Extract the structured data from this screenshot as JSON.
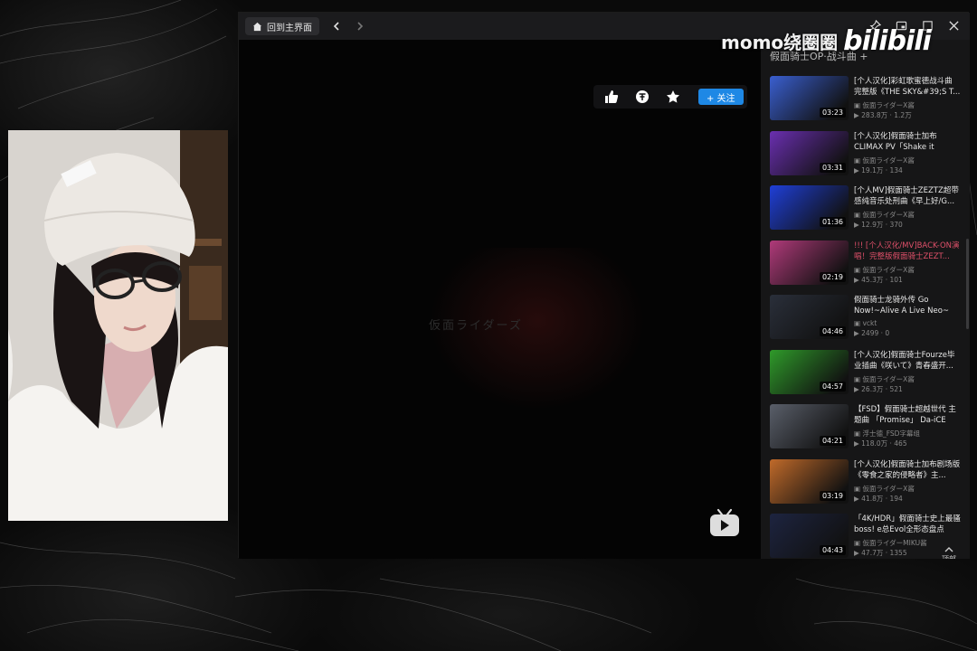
{
  "toolbar": {
    "home_label": "回到主界面"
  },
  "watermark": {
    "channel": "momo绕圈圈",
    "logo": "bilibili"
  },
  "player": {
    "stage_text": "仮面ライダーズ",
    "follow_label": "+ 关注"
  },
  "sidebar": {
    "list_title": "假面骑士OP·战斗曲 +",
    "to_top": "顶部",
    "items": [
      {
        "title": "[个人汉化]彩虹歌蜜德战斗曲 完整版《THE SKY&#39;S T...",
        "duration": "03:23",
        "uploader": "仮面ライダーX酱",
        "stats": "283.8万 · 1.2万",
        "red": false,
        "thumb": "#3a5fd0"
      },
      {
        "title": "[个人汉化]假面骑士加布 CLIMAX PV「Shake it off」！ 总...",
        "duration": "03:31",
        "uploader": "仮面ライダーX酱",
        "stats": "19.1万 · 134",
        "red": false,
        "thumb": "#6a2fb0"
      },
      {
        "title": "[个人MV]假面骑士ZEZTZ超带感纯音乐处刑曲《早上好/G...",
        "duration": "01:36",
        "uploader": "仮面ライダーX酱",
        "stats": "12.9万 · 370",
        "red": false,
        "thumb": "#1f3fd8"
      },
      {
        "title": "!!! [个人汉化/MV]BACK-ON演唱！完整版假面骑士ZEZT...",
        "duration": "02:19",
        "uploader": "仮面ライダーX酱",
        "stats": "45.3万 · 101",
        "red": true,
        "thumb": "#b03a7a"
      },
      {
        "title": "假面骑士龙骑外传 Go Now!~Alive A Live Neo~ MV",
        "duration": "04:46",
        "uploader": "vckt",
        "stats": "2499 · 0",
        "red": false,
        "thumb": "#2a2f3a"
      },
      {
        "title": "[个人汉化]假面骑士Fourze毕业插曲《咲いて》青春盛开...",
        "duration": "04:57",
        "uploader": "仮面ライダーX酱",
        "stats": "26.3万 · 521",
        "red": false,
        "thumb": "#2f9a2a"
      },
      {
        "title": "【FSD】假面骑士超越世代 主题曲 「Promise」 Da-iCE演...",
        "duration": "04:21",
        "uploader": "浮士德_FSD字幕组",
        "stats": "118.0万 · 465",
        "red": false,
        "thumb": "#5a5f6a"
      },
      {
        "title": "[个人汉化]假面骑士加布剧场版《零食之家的侵略者》主...",
        "duration": "03:19",
        "uploader": "仮面ライダーX酱",
        "stats": "41.8万 · 194",
        "red": false,
        "thumb": "#c06a2a"
      },
      {
        "title": "「4K/HDR」假面骑士史上最骚boss! e总Evol全形态盘点",
        "duration": "04:43",
        "uploader": "仮面ライダーMIKU酱",
        "stats": "47.7万 · 1355",
        "red": false,
        "thumb": "#1d2440"
      }
    ]
  }
}
